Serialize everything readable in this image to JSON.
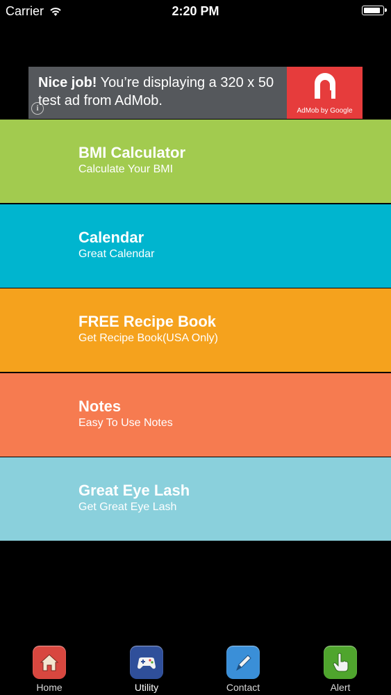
{
  "status_bar": {
    "carrier": "Carrier",
    "time": "2:20 PM",
    "battery_level": 0.95
  },
  "ad": {
    "headline": "Nice job!",
    "body": " You’re displaying a 320 x 50 test ad from AdMob.",
    "info_icon": "info-icon",
    "logo_text": "AdMob by Google",
    "logo_color": "#e63c3c"
  },
  "menu": {
    "items": [
      {
        "title": "BMI Calculator",
        "subtitle": "Calculate Your BMI",
        "color": "#a2cb4f"
      },
      {
        "title": "Calendar",
        "subtitle": "Great Calendar",
        "color": "#00b5cf"
      },
      {
        "title": "FREE Recipe Book",
        "subtitle": "Get Recipe Book(USA Only)",
        "color": "#f5a21d"
      },
      {
        "title": "Notes",
        "subtitle": "Easy To Use Notes",
        "color": "#f67b50"
      },
      {
        "title": "Great Eye Lash",
        "subtitle": "Get Great Eye Lash",
        "color": "#8ad0dc"
      }
    ]
  },
  "tab_bar": {
    "tabs": [
      {
        "label": "Home",
        "icon": "home-icon",
        "color": "#d8473f"
      },
      {
        "label": "Utility",
        "icon": "gamepad-icon",
        "color": "#2f4f9a",
        "active": true
      },
      {
        "label": "Contact",
        "icon": "pen-icon",
        "color": "#3a8fd8"
      },
      {
        "label": "Alert",
        "icon": "hand-pointer-icon",
        "color": "#4fa52d"
      }
    ]
  }
}
